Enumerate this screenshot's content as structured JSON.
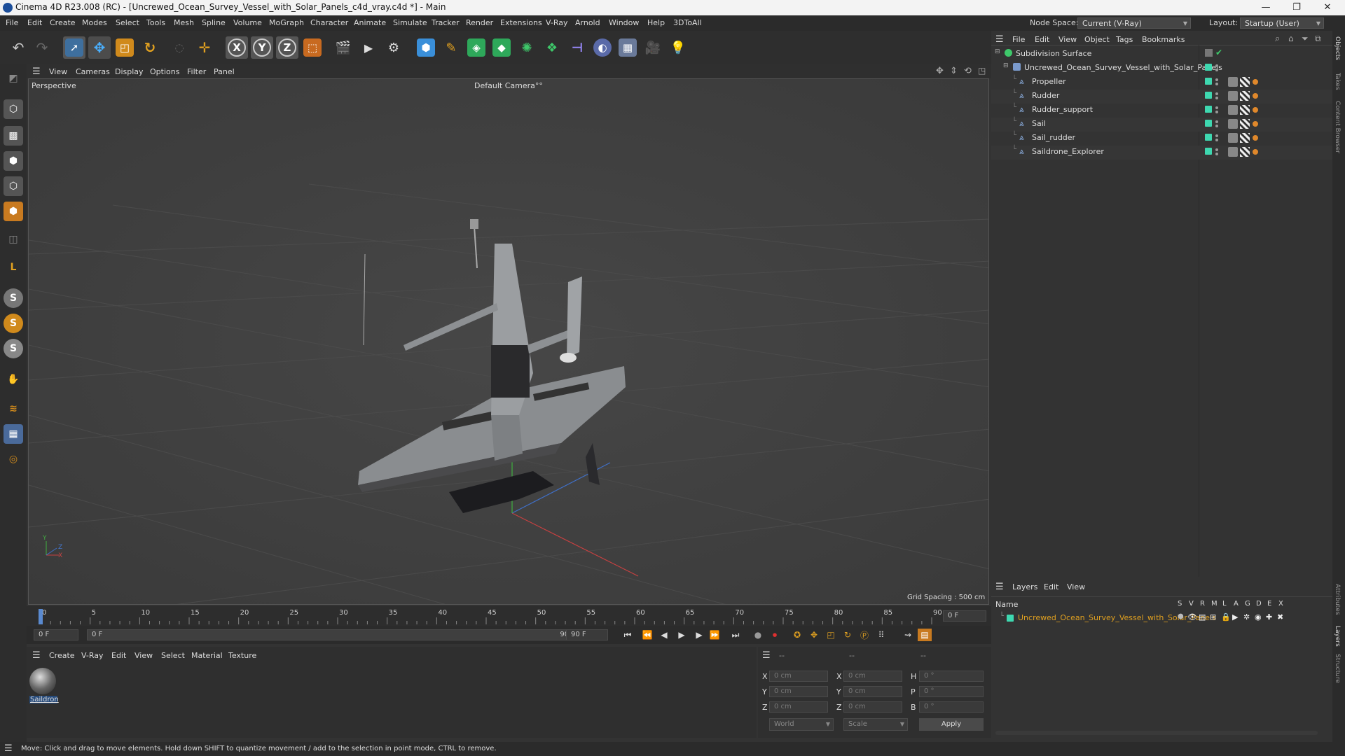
{
  "window": {
    "title": "Cinema 4D R23.008 (RC) - [Uncrewed_Ocean_Survey_Vessel_with_Solar_Panels_c4d_vray.c4d *] - Main",
    "controls": [
      "—",
      "❐",
      "✕"
    ]
  },
  "menubar": {
    "items": [
      "File",
      "Edit",
      "Create",
      "Modes",
      "Select",
      "Tools",
      "Mesh",
      "Spline",
      "Volume",
      "MoGraph",
      "Character",
      "Animate",
      "Simulate",
      "Tracker",
      "Render",
      "Extensions",
      "V-Ray",
      "Arnold",
      "Window",
      "Help",
      "3DToAll"
    ],
    "node_space_label": "Node Space:",
    "node_space_value": "Current (V-Ray)",
    "layout_label": "Layout:",
    "layout_value": "Startup (User)"
  },
  "viewport": {
    "menu": [
      "View",
      "Cameras",
      "Display",
      "Options",
      "Filter",
      "Panel"
    ],
    "view_name": "Perspective",
    "camera": "Default Camera",
    "camera_mark": "°°",
    "grid_spacing": "Grid Spacing : 500 cm",
    "axis_labels": {
      "y": "Y",
      "z": "Z",
      "x": "X"
    }
  },
  "timeline": {
    "ticks": [
      "0",
      "5",
      "10",
      "15",
      "20",
      "25",
      "30",
      "35",
      "40",
      "45",
      "50",
      "55",
      "60",
      "65",
      "70",
      "75",
      "80",
      "85",
      "90"
    ],
    "current_frame": "0 F",
    "start_field": "0 F",
    "range_start": "0 F",
    "range_end": "90 F",
    "end_field": "90 F"
  },
  "material_panel": {
    "menu": [
      "Create",
      "V-Ray",
      "Edit",
      "View",
      "Select",
      "Material",
      "Texture"
    ],
    "materials": [
      {
        "name": "Saildron"
      }
    ]
  },
  "coord_panel": {
    "headers": [
      "--",
      "--",
      "--"
    ],
    "rows": [
      {
        "a": "X",
        "av": "0 cm",
        "b": "X",
        "bv": "0 cm",
        "c": "H",
        "cv": "0 °"
      },
      {
        "a": "Y",
        "av": "0 cm",
        "b": "Y",
        "bv": "0 cm",
        "c": "P",
        "cv": "0 °"
      },
      {
        "a": "Z",
        "av": "0 cm",
        "b": "Z",
        "bv": "0 cm",
        "c": "B",
        "cv": "0 °"
      }
    ],
    "mode": "World",
    "scale": "Scale",
    "apply": "Apply"
  },
  "object_manager": {
    "menu": [
      "File",
      "Edit",
      "View",
      "Object",
      "Tags",
      "Bookmarks"
    ],
    "root": "Subdivision Surface",
    "group": "Uncrewed_Ocean_Survey_Vessel_with_Solar_Panels",
    "objects": [
      "Propeller",
      "Rudder",
      "Rudder_support",
      "Sail",
      "Sail_rudder",
      "Saildrone_Explorer"
    ]
  },
  "layer_manager": {
    "menu": [
      "Layers",
      "Edit",
      "View"
    ],
    "name_header": "Name",
    "columns": [
      "S",
      "V",
      "R",
      "M",
      "L",
      "A",
      "G",
      "D",
      "E",
      "X"
    ],
    "layers": [
      {
        "name": "Uncrewed_Ocean_Survey_Vessel_with_Solar_Panels",
        "color": "#3ed8b0"
      }
    ]
  },
  "right_tabs": [
    "Objects",
    "Takes",
    "Content Browser",
    "Attributes",
    "Layers",
    "Structure"
  ],
  "status": "Move: Click and drag to move elements. Hold down SHIFT to quantize movement / add to the selection in point mode, CTRL to remove.",
  "colors": {
    "accent": "#3ed8b0",
    "select_orange": "#e0a020",
    "layer_text": "#e0a020"
  }
}
